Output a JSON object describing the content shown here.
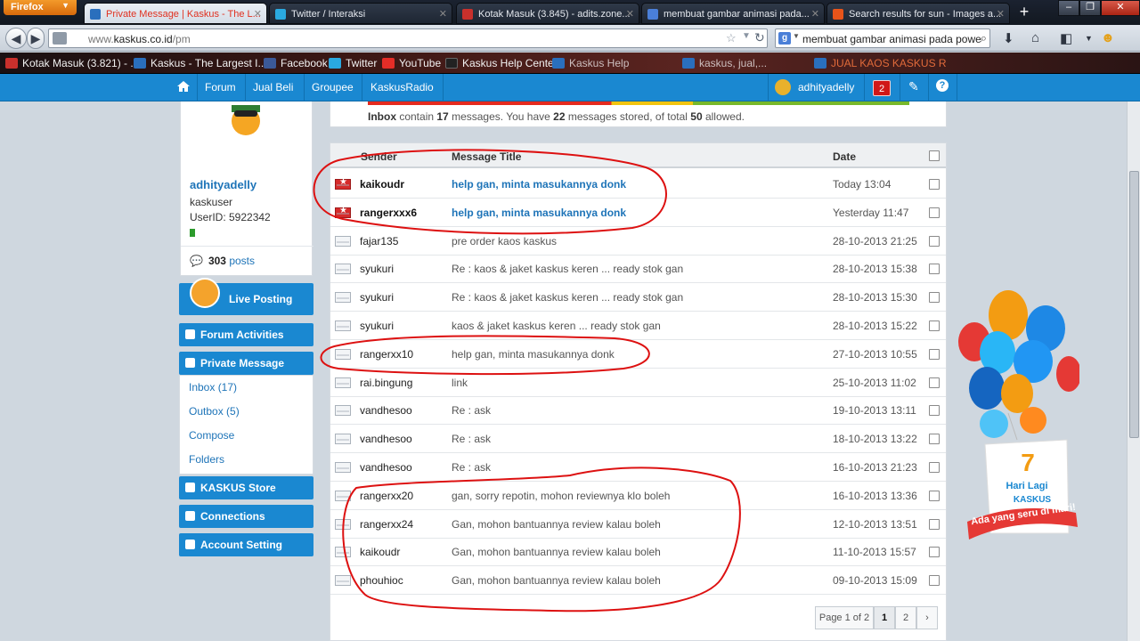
{
  "browser": {
    "menu_label": "Firefox",
    "tabs": [
      {
        "title": "Private Message | Kaskus - The L...",
        "active": true,
        "color": "#2a6fbd"
      },
      {
        "title": "Twitter / Interaksi",
        "active": false,
        "color": "#2aa9e0"
      },
      {
        "title": "Kotak Masuk (3.845) - adits.zone...",
        "active": false,
        "color": "#c9302c"
      },
      {
        "title": "membuat gambar animasi pada...",
        "active": false,
        "color": "#4a7fd8"
      },
      {
        "title": "Search results for sun - Images a...",
        "active": false,
        "color": "#e8541a"
      }
    ],
    "url_prefix": "www.",
    "url_host": "kaskus.co.id",
    "url_path": "/pm",
    "search_value": "membuat gambar animasi pada powe",
    "bookmarks": [
      {
        "label": "Kotak Masuk (3.821) - ...",
        "color": "#c9302c"
      },
      {
        "label": "Kaskus - The Largest I...",
        "color": "#2a6fbd"
      },
      {
        "label": "Facebook",
        "color": "#3b5998"
      },
      {
        "label": "Twitter",
        "color": "#2aa9e0"
      },
      {
        "label": "YouTube",
        "color": "#e52d27"
      },
      {
        "label": "Kaskus Help Center",
        "color": "#222222"
      },
      {
        "label": "Kaskus Help",
        "color": "#2a6fbd"
      },
      {
        "label": "kaskus, jual,...",
        "color": "#2a6fbd"
      },
      {
        "label": "JUAL KAOS KASKUS R",
        "color": "#2a6fbd"
      }
    ]
  },
  "kaskus_nav": {
    "links": [
      "Forum",
      "Jual Beli",
      "Groupee",
      "KaskusRadio"
    ],
    "username": "adhityadelly",
    "notif_count": "2"
  },
  "profile": {
    "username": "adhityadelly",
    "title": "kaskuser",
    "userid": "UserID: 5922342",
    "posts_count": "303",
    "posts_label": "posts"
  },
  "sidebar": {
    "live_posting": "Live Posting",
    "forum_activities": "Forum Activities",
    "private_message": "Private Message",
    "pm_links": [
      "Inbox (17)",
      "Outbox (5)",
      "Compose",
      "Folders"
    ],
    "store": "KASKUS Store",
    "connections": "Connections",
    "account": "Account Setting"
  },
  "quota": {
    "prefix": "Inbox",
    "t1": " contain ",
    "count": "17",
    "t2": " messages. You have ",
    "stored": "22",
    "t3": " messages stored, of total ",
    "total": "50",
    "t4": " allowed."
  },
  "table": {
    "headers": {
      "sender": "Sender",
      "title": "Message Title",
      "date": "Date"
    },
    "rows": [
      {
        "sender": "kaikoudr",
        "title": "help gan, minta masukannya donk",
        "date": "Today 13:04",
        "unread": true
      },
      {
        "sender": "rangerxxx6",
        "title": "help gan, minta masukannya donk",
        "date": "Yesterday 11:47",
        "unread": true
      },
      {
        "sender": "fajar135",
        "title": "pre order kaos kaskus",
        "date": "28-10-2013 21:25",
        "unread": false
      },
      {
        "sender": "syukuri",
        "title": "Re : kaos & jaket kaskus keren ... ready stok gan",
        "date": "28-10-2013 15:38",
        "unread": false
      },
      {
        "sender": "syukuri",
        "title": "Re : kaos & jaket kaskus keren ... ready stok gan",
        "date": "28-10-2013 15:30",
        "unread": false
      },
      {
        "sender": "syukuri",
        "title": "kaos & jaket kaskus keren ... ready stok gan",
        "date": "28-10-2013 15:22",
        "unread": false
      },
      {
        "sender": "rangerxx10",
        "title": "help gan, minta masukannya donk",
        "date": "27-10-2013 10:55",
        "unread": false
      },
      {
        "sender": "rai.bingung",
        "title": "link",
        "date": "25-10-2013 11:02",
        "unread": false
      },
      {
        "sender": "vandhesoo",
        "title": "Re : ask",
        "date": "19-10-2013 13:11",
        "unread": false
      },
      {
        "sender": "vandhesoo",
        "title": "Re : ask",
        "date": "18-10-2013 13:22",
        "unread": false
      },
      {
        "sender": "vandhesoo",
        "title": "Re : ask",
        "date": "16-10-2013 21:23",
        "unread": false
      },
      {
        "sender": "rangerxx20",
        "title": "gan, sorry repotin, mohon reviewnya klo boleh",
        "date": "16-10-2013 13:36",
        "unread": false
      },
      {
        "sender": "rangerxx24",
        "title": "Gan, mohon bantuannya review kalau boleh",
        "date": "12-10-2013 13:51",
        "unread": false
      },
      {
        "sender": "kaikoudr",
        "title": "Gan, mohon bantuannya review kalau boleh",
        "date": "11-10-2013 15:57",
        "unread": false
      },
      {
        "sender": "phouhioc",
        "title": "Gan, mohon bantuannya review kalau boleh",
        "date": "09-10-2013 15:09",
        "unread": false
      }
    ]
  },
  "pager": {
    "label": "Page 1 of 2",
    "pages": [
      "1",
      "2"
    ],
    "next": "›"
  },
  "promo": {
    "days": "7",
    "label": "Hari Lagi",
    "brand": "KASKUS",
    "tagline": "Ada yang seru di mari!"
  },
  "colors": {
    "kaskus_blue": "#1a88d1",
    "annotation_red": "#dd1111",
    "unread_link": "#1e74b8"
  }
}
